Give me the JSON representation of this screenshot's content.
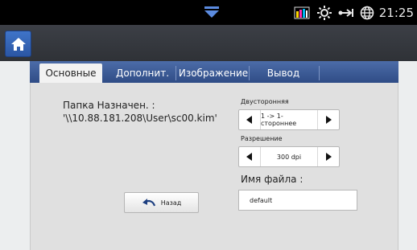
{
  "status_bar": {
    "time": "21:25",
    "icons": [
      "notification-chevron-icon",
      "toner-levels-icon",
      "sun-icon",
      "network-icon",
      "globe-icon"
    ],
    "accent_color": "#5b8be0"
  },
  "header": {
    "home_icon": "home-icon"
  },
  "tabs": [
    {
      "label": "Основные",
      "active": true
    },
    {
      "label": "Дополнит.",
      "active": false
    },
    {
      "label": "Изображение",
      "active": false
    },
    {
      "label": "Вывод",
      "active": false
    }
  ],
  "destination": {
    "label": "Папка Назначен. :",
    "value": "'\\\\10.88.181.208\\User\\sc00.kim'"
  },
  "duplex": {
    "label": "Двусторонняя",
    "value": "1 -> 1-стороннее"
  },
  "resolution": {
    "label": "Разрешение",
    "value": "300 dpi"
  },
  "filename": {
    "label": "Имя файла :",
    "value": "default"
  },
  "back_button": {
    "label": "Назад"
  },
  "colors": {
    "tab_bar": "#3b5a96",
    "home_button": "#3566b8",
    "panel_bg": "#e0e0e0"
  }
}
